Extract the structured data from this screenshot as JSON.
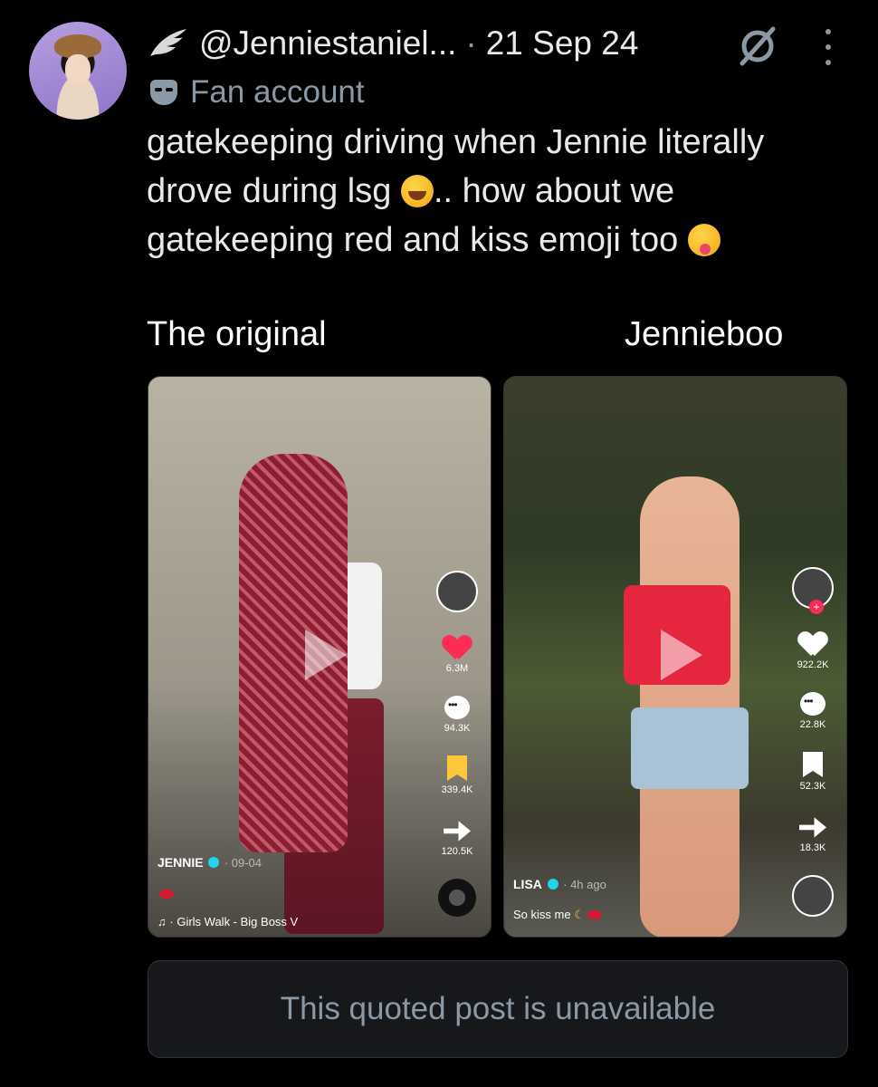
{
  "post": {
    "handle": "@Jenniestaniel...",
    "separator": "·",
    "date": "21 Sep 24",
    "badge_label": "Fan account",
    "text_line1": "gatekeeping driving when Jennie literally",
    "text_line2a": "drove during lsg",
    "text_line2b": ".. how about we",
    "text_line3": "gatekeeping red and kiss emoji too"
  },
  "media": {
    "left_label": "The original",
    "right_label": "Jennieboo",
    "left": {
      "likes": "6.3M",
      "comments": "94.3K",
      "saves": "339.4K",
      "shares": "120.5K",
      "username": "JENNIE",
      "posted": "· 09-04",
      "music": "Girls Walk - Big Boss V"
    },
    "right": {
      "likes": "922.2K",
      "comments": "22.8K",
      "saves": "52.3K",
      "shares": "18.3K",
      "username": "LISA",
      "posted": "· 4h ago",
      "caption": "So kiss me"
    }
  },
  "quoted": {
    "text": "This quoted post is unavailable"
  },
  "colors": {
    "background": "#000000",
    "text_primary": "#e7e9ea",
    "text_secondary": "#8b98a5",
    "like_red": "#fe2c55",
    "save_yellow": "#fdc63b"
  },
  "icons": [
    "wing-icon",
    "grok-icon",
    "more-icon",
    "mask-icon",
    "heart-icon",
    "comment-icon",
    "bookmark-icon",
    "share-icon",
    "play-icon",
    "music-icon"
  ]
}
